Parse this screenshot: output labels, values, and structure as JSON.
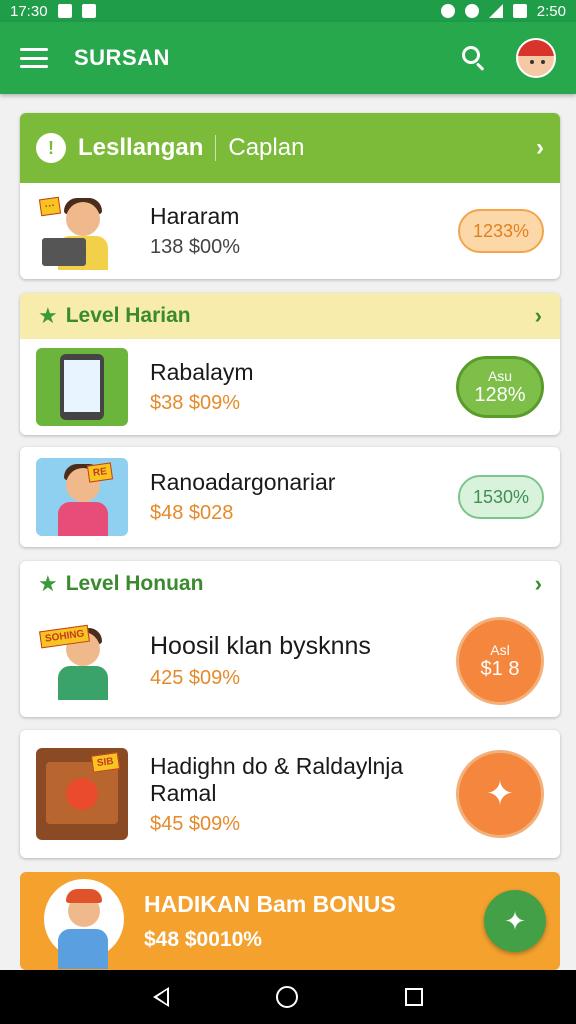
{
  "status": {
    "time_left": "17:30",
    "time_right": "2:50"
  },
  "app": {
    "title": "SURSAN"
  },
  "banner": {
    "title": "Lesllangan",
    "subtitle": "Caplan"
  },
  "item1": {
    "name": "Hararam",
    "price": "138 $00%",
    "badge": "1233%"
  },
  "section1": {
    "label": "Level Harian"
  },
  "item2": {
    "name": "Rabalaym",
    "price": "$38 $09%",
    "badge_top": "Asu",
    "badge_bottom": "128%"
  },
  "item3": {
    "name": "Ranoadargonariar",
    "price": "$48 $028",
    "badge": "1530%",
    "thumb_tag": "RE"
  },
  "section2": {
    "label": "Level Honuan"
  },
  "item4": {
    "name": "Hoosil klan bysknns",
    "price": "425 $09%",
    "badge_top": "Asl",
    "badge_bottom": "$1 8",
    "thumb_tag": "SOHING"
  },
  "item5": {
    "name_line1": "Hadighn do & Raldaylnja",
    "name_line2": "Ramal",
    "price": "$45 $09%",
    "thumb_tag": "SIB"
  },
  "bonus": {
    "title": "HADIKAN Bam BONUS",
    "price": "$48 $0010%"
  },
  "colors": {
    "appbar": "#28a84c",
    "banner": "#7cbb3a",
    "bonus": "#f4a12e",
    "accent_orange": "#f4863d"
  }
}
